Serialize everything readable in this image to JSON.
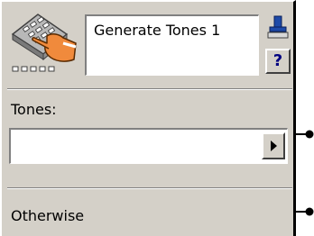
{
  "node": {
    "title": "Generate Tones 1",
    "help_label": "?",
    "icon": "phone-keypad-icon",
    "stamp_icon": "stamp-icon"
  },
  "tones": {
    "label": "Tones:",
    "value": ""
  },
  "otherwise": {
    "label": "Otherwise"
  },
  "colors": {
    "panel": "#d4d0c8",
    "help_text": "#000080",
    "connector": "#000000"
  }
}
